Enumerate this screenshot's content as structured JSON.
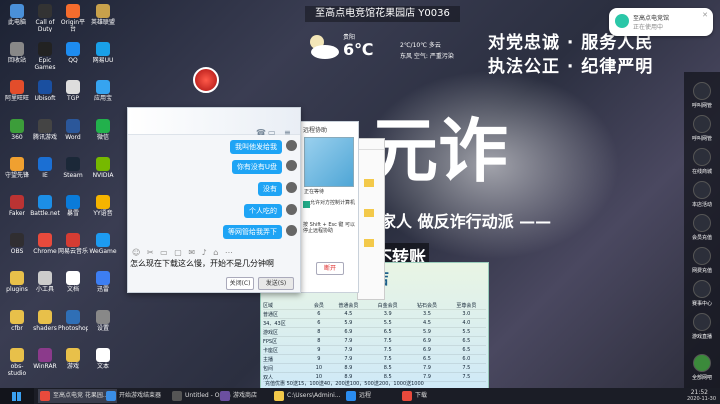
{
  "desktop": {
    "banner": "至高点电竞馆花果园店 Y0036",
    "weather": {
      "city": "贵阳",
      "temp": "6℃",
      "range": "2℃/10℃ 多云",
      "air": "东风 空气: 严重污染"
    },
    "slogans": [
      "对党忠诚 · 服务人民",
      "执法公正 · 纪律严明"
    ],
    "big_text": "元诈",
    "subtitle": "家人 做反诈行动派 ——",
    "subtitle2": "不转账",
    "icons": [
      {
        "label": "此电脑",
        "color": "#4a90d9"
      },
      {
        "label": "Call of Duty",
        "color": "#333"
      },
      {
        "label": "Origin平台",
        "color": "#f56c2d"
      },
      {
        "label": "英雄联盟",
        "color": "#c8a14b"
      },
      {
        "label": "回收站",
        "color": "#888"
      },
      {
        "label": "Epic Games",
        "color": "#222"
      },
      {
        "label": "QQ",
        "color": "#1d8cf0"
      },
      {
        "label": "网易UU",
        "color": "#19a0e8"
      },
      {
        "label": "阿里旺旺",
        "color": "#e34d2b"
      },
      {
        "label": "Ubisoft",
        "color": "#1a4fa0"
      },
      {
        "label": "TGP",
        "color": "#ddd"
      },
      {
        "label": "应用宝",
        "color": "#36a4f0"
      },
      {
        "label": "360",
        "color": "#3c9d3a"
      },
      {
        "label": "腾讯游戏",
        "color": "#444"
      },
      {
        "label": "Word",
        "color": "#2b579a"
      },
      {
        "label": "微信",
        "color": "#22b14c"
      },
      {
        "label": "守望先锋",
        "color": "#f0a030"
      },
      {
        "label": "IE",
        "color": "#1b6fd3"
      },
      {
        "label": "Steam",
        "color": "#1b2838"
      },
      {
        "label": "NVIDIA",
        "color": "#76b900"
      },
      {
        "label": "Faker",
        "color": "#b33"
      },
      {
        "label": "Battle.net",
        "color": "#1c8ee6"
      },
      {
        "label": "暴雪",
        "color": "#0a7bd9"
      },
      {
        "label": "YY语音",
        "color": "#f5b400"
      },
      {
        "label": "OBS",
        "color": "#302e31"
      },
      {
        "label": "Chrome",
        "color": "#e84a3c"
      },
      {
        "label": "网易云音乐",
        "color": "#d43c33"
      },
      {
        "label": "WeGame",
        "color": "#1d9bf0"
      },
      {
        "label": "plugins",
        "color": "#e8c04a"
      },
      {
        "label": "小工具",
        "color": "#ccc"
      },
      {
        "label": "文档",
        "color": "#fff"
      },
      {
        "label": "迅雷",
        "color": "#3d7ef2"
      },
      {
        "label": "cfbr",
        "color": "#e8c04a"
      },
      {
        "label": "shaders",
        "color": "#e8c04a"
      },
      {
        "label": "Photoshop",
        "color": "#2f6fb6"
      },
      {
        "label": "设置",
        "color": "#888"
      },
      {
        "label": "obs-studio",
        "color": "#e8c04a"
      },
      {
        "label": "WinRAR",
        "color": "#8b3a8b"
      },
      {
        "label": "游戏",
        "color": "#e8c04a"
      },
      {
        "label": "文本",
        "color": "#fff"
      }
    ]
  },
  "chat": {
    "messages": [
      "我叫他发给我",
      "你有没有U盘",
      "没有",
      "个人吃的",
      "等网管给我弄下"
    ],
    "input": "怎么现在下载这么慢，开始不是几分钟啊",
    "close_label": "关闭(C)",
    "send_label": "发送(S)"
  },
  "right_panel": {
    "title": "远程协助",
    "status": "正在等待",
    "checkbox": "允许对方控制计算机",
    "hint": "按 Shift + Esc 键 可以停止远程协助",
    "end_label": "断开"
  },
  "fee_table": {
    "title": "店",
    "columns": [
      "区域",
      "会员",
      "普通会员",
      "白金会员",
      "钻石会员",
      "至尊会员"
    ],
    "rows": [
      [
        "普通区",
        "6",
        "4.5",
        "3.9",
        "3.5",
        "3.0"
      ],
      [
        "34、43区",
        "6",
        "5.9",
        "5.5",
        "4.5",
        "4.0"
      ],
      [
        "游戏区",
        "8",
        "6.9",
        "6.5",
        "5.9",
        "5.5"
      ],
      [
        "FPS区",
        "8",
        "7.9",
        "7.5",
        "6.9",
        "6.5"
      ],
      [
        "卡座区",
        "9",
        "7.9",
        "7.5",
        "6.9",
        "6.5"
      ],
      [
        "主播",
        "9",
        "7.9",
        "7.5",
        "6.5",
        "6.0"
      ],
      [
        "包间",
        "10",
        "8.9",
        "8.5",
        "7.9",
        "7.5"
      ],
      [
        "双人",
        "10",
        "8.9",
        "8.5",
        "7.9",
        "7.5"
      ]
    ],
    "footer": "充值优惠 50送15，100送40，200送100，500送200，1000送1000"
  },
  "sidebar": {
    "items": [
      "呼叫网管",
      "呼叫网管",
      "在线商城",
      "本店活动",
      "会员充值",
      "网费充值",
      "赛事中心",
      "游戏直播"
    ],
    "bottom_label": "全部网吧"
  },
  "notification": {
    "line1": "至高点电竞馆",
    "line2": "正在使用中"
  },
  "taskbar": {
    "items": [
      "至高点电竞 花果园...",
      "开始游戏结束器",
      "Untitled - Open B...",
      "游戏商店",
      "C:\\Users\\Admini...",
      "远程",
      "下载"
    ],
    "time": "21:52",
    "date": "2020-11-30"
  }
}
